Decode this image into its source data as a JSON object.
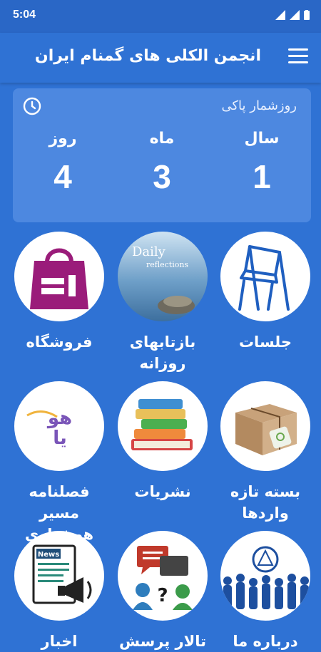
{
  "status": {
    "time": "5:04"
  },
  "header": {
    "title": "انجمن الکلی های گمنام ایران"
  },
  "counter": {
    "title": "روزشمار پاکی",
    "year_label": "سال",
    "year_value": "1",
    "month_label": "ماه",
    "month_value": "3",
    "day_label": "روز",
    "day_value": "4"
  },
  "tiles": [
    {
      "label": "جلسات"
    },
    {
      "label": "بازتابهای\nروزانه",
      "line1": "بازتابهای",
      "line2": "روزانه",
      "image_text_1": "Daily",
      "image_text_2": "reflections"
    },
    {
      "label": "فروشگاه"
    },
    {
      "label": "بسته تازه\nواردها",
      "line1": "بسته تازه",
      "line2": "واردها"
    },
    {
      "label": "نشریات"
    },
    {
      "label": "فصلنامه مسیر\nهوشیاری",
      "line1": "فصلنامه مسیر",
      "line2": "هوشیاری"
    },
    {
      "label": "درباره ما"
    },
    {
      "label": "تالار پرسش"
    },
    {
      "label": "اخبار",
      "image_text": "News"
    }
  ],
  "colors": {
    "background": "#2f72d4",
    "card": "#4d88e0",
    "status_bar": "#2a67c6"
  }
}
